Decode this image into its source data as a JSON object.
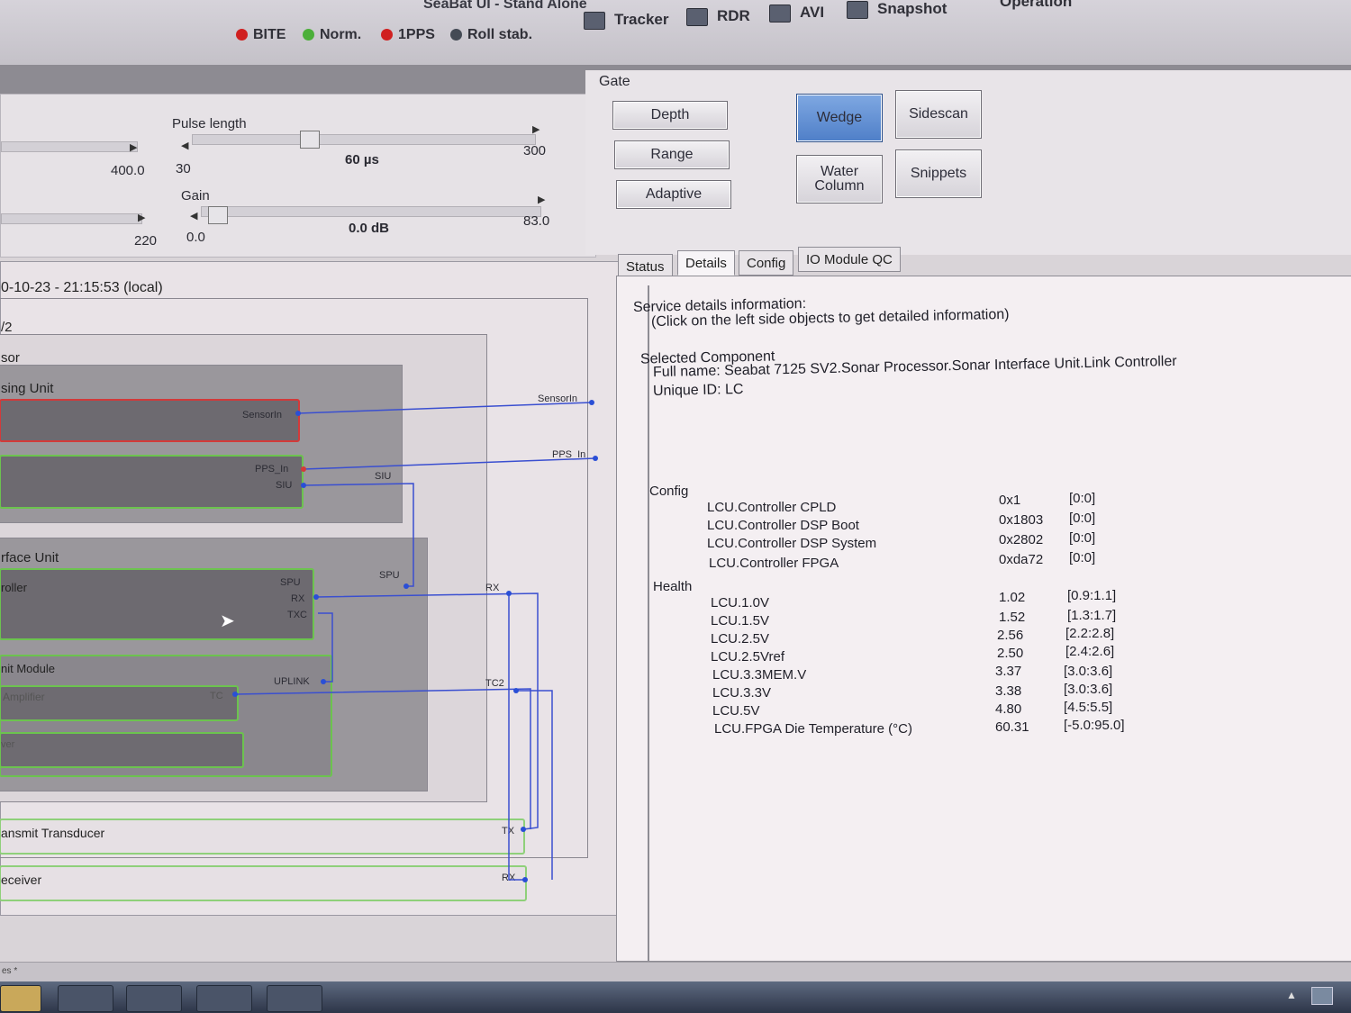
{
  "window": {
    "title": "SeaBat UI - Stand Alone"
  },
  "status_bar": [
    {
      "label": "BITE",
      "led": "#d02020"
    },
    {
      "label": "Norm.",
      "led": "#4caf3a"
    },
    {
      "label": "1PPS",
      "led": "#d02020"
    },
    {
      "label": "Roll stab.",
      "led": "#444a55"
    }
  ],
  "toolbar": {
    "tracker": "Tracker",
    "rdr": "RDR",
    "avi": "AVI",
    "snapshot": "Snapshot",
    "operation": "Operation"
  },
  "controls": {
    "left_max": "400.0",
    "left_max2": "220",
    "pulse": {
      "label": "Pulse length",
      "min": "30",
      "value": "60 µs",
      "max": "300"
    },
    "gain": {
      "label": "Gain",
      "min": "0.0",
      "value": "0.0 dB",
      "max": "83.0"
    }
  },
  "gate": {
    "label": "Gate",
    "depth": "Depth",
    "range": "Range",
    "adaptive": "Adaptive",
    "wedge": "Wedge",
    "sidescan": "Sidescan",
    "water_column_1": "Water",
    "water_column_2": "Column",
    "snippets": "Snippets",
    "active": "Wedge"
  },
  "diagram": {
    "timestamp": "0-10-23 - 21:15:53 (local)",
    "l1": "/2",
    "l2": "sor",
    "processing_unit": "sing Unit",
    "interface_unit": "rface Unit",
    "controller": "roller",
    "uplink_module": "nit Module",
    "amplifier": "Amplifier",
    "lower_mod": "ver",
    "transmit": "ansmit Transducer",
    "receiver": "eceiver",
    "ports": {
      "sensorin": "SensorIn",
      "sensorin_out": "SensorIn",
      "pps_in_a": "PPS_In",
      "siu": "SIU",
      "siu_b": "SIU",
      "pps_in_out": "PPS_In",
      "spu": "SPU",
      "rx": "RX",
      "txc": "TXC",
      "spu_b": "SPU",
      "rx_out": "RX",
      "uplink": "UPLINK",
      "tc": "TC",
      "tc2": "TC2",
      "tx": "TX",
      "rx_recv": "RX"
    }
  },
  "tabs": [
    "Status",
    "Details",
    "Config",
    "IO Module QC"
  ],
  "details": {
    "heading": "Service details information:",
    "hint": "(Click on the left side objects to get detailed information)",
    "selected": "Selected Component",
    "full_name": "Full name: Seabat 7125 SV2.Sonar Processor.Sonar Interface Unit.Link Controller",
    "unique_id": "Unique ID: LC",
    "config_label": "Config",
    "config": [
      {
        "name": "LCU.Controller CPLD",
        "value": "0x1",
        "range": "[0:0]"
      },
      {
        "name": "LCU.Controller DSP Boot",
        "value": "0x1803",
        "range": "[0:0]"
      },
      {
        "name": "LCU.Controller DSP System",
        "value": "0x2802",
        "range": "[0:0]"
      },
      {
        "name": "LCU.Controller FPGA",
        "value": "0xda72",
        "range": "[0:0]"
      }
    ],
    "health_label": "Health",
    "health": [
      {
        "name": "LCU.1.0V",
        "value": "1.02",
        "range": "[0.9:1.1]"
      },
      {
        "name": "LCU.1.5V",
        "value": "1.52",
        "range": "[1.3:1.7]"
      },
      {
        "name": "LCU.2.5V",
        "value": "2.56",
        "range": "[2.2:2.8]"
      },
      {
        "name": "LCU.2.5Vref",
        "value": "2.50",
        "range": "[2.4:2.6]"
      },
      {
        "name": "LCU.3.3MEM.V",
        "value": "3.37",
        "range": "[3.0:3.6]"
      },
      {
        "name": "LCU.3.3V",
        "value": "3.38",
        "range": "[3.0:3.6]"
      },
      {
        "name": "LCU.5V",
        "value": "4.80",
        "range": "[4.5:5.5]"
      },
      {
        "name": "LCU.FPGA Die Temperature (°C)",
        "value": "60.31",
        "range": "[-5.0:95.0]"
      }
    ]
  },
  "bottom": {
    "scroll_label": "es *"
  }
}
